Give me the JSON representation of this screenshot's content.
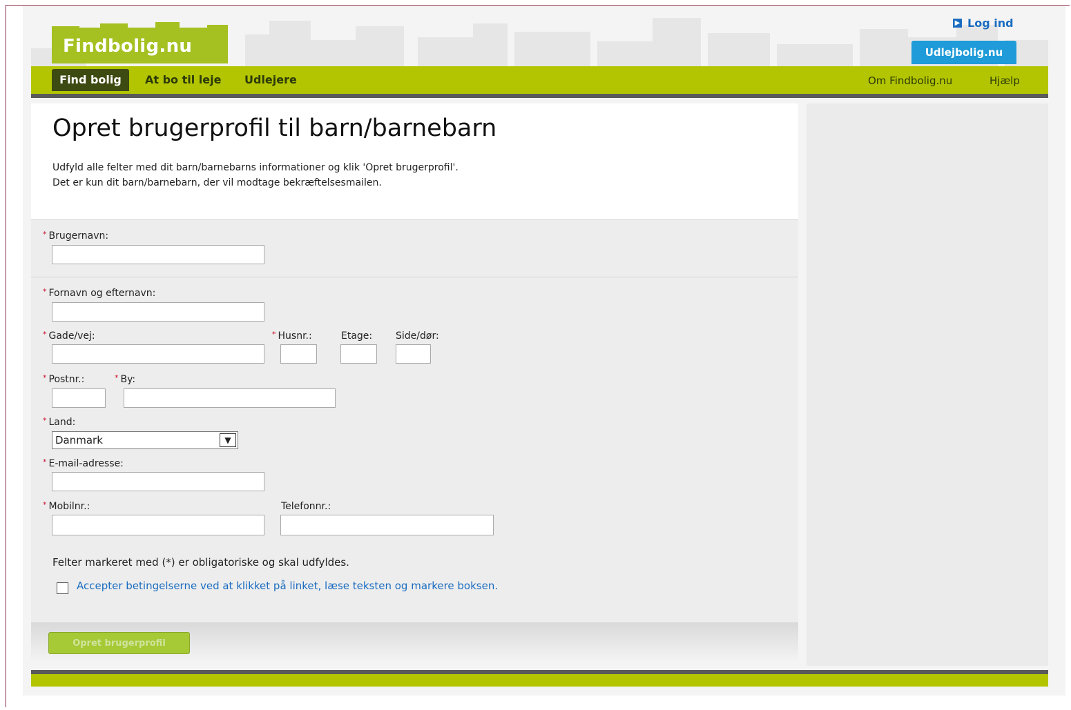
{
  "brand": {
    "logo": "Findbolig.nu",
    "partner_tab": "Udlejbolig.nu",
    "login": "Log ind"
  },
  "nav": {
    "active": "Find bolig",
    "items": [
      "At bo til leje",
      "Udlejere"
    ],
    "right": [
      "Om Findbolig.nu",
      "Hjælp"
    ]
  },
  "page": {
    "title": "Opret brugerprofil til barn/barnebarn",
    "intro": "Udfyld alle felter med dit barn/barnebarns informationer og klik 'Opret brugerprofil'. Det er kun dit barn/barnebarn, der vil modtage bekræftelsesmailen."
  },
  "form": {
    "username_label": "Brugernavn:",
    "name_label": "Fornavn og efternavn:",
    "street_label": "Gade/vej:",
    "housenr_label": "Husnr.:",
    "floor_label": "Etage:",
    "side_label": "Side/dør:",
    "postal_label": "Postnr.:",
    "city_label": "By:",
    "country_label": "Land:",
    "country_value": "Danmark",
    "email_label": "E-mail-adresse:",
    "mobile_label": "Mobilnr.:",
    "phone_label": "Telefonnr.:",
    "required_marker": "*",
    "required_note": "Felter markeret med (*) er obligatoriske og skal udfyldes.",
    "accept_text": "Accepter betingelserne ved at klikket på linket, læse teksten og markere boksen.",
    "submit": "Opret brugerprofil"
  },
  "colors": {
    "brand_green": "#a5c021",
    "nav_green": "#b2c500",
    "link_blue": "#1a6cc0",
    "required_red": "#c8102e"
  }
}
